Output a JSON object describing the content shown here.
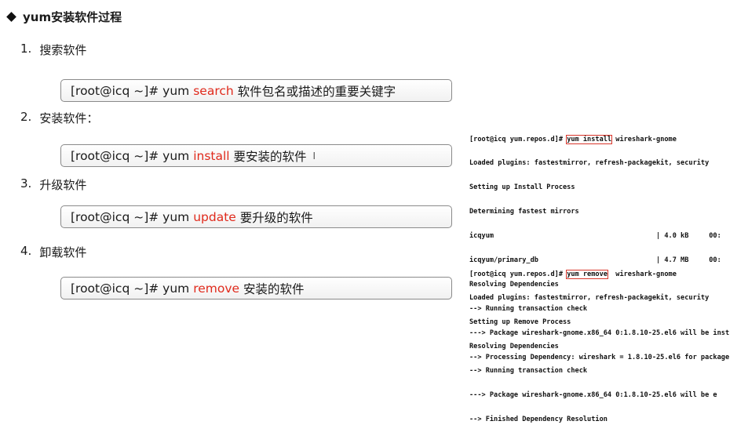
{
  "title": "yum安装软件过程",
  "steps": [
    {
      "num": "1.",
      "label": "搜索软件",
      "cmd_prefix": "[root@icq ~]# yum ",
      "cmd_keyword": "search",
      "cmd_suffix": " 软件包名或描述的重要关键字"
    },
    {
      "num": "2.",
      "label": "安装软件：",
      "cmd_prefix": "[root@icq ~]# yum ",
      "cmd_keyword": "install",
      "cmd_suffix": " 要安装的软件"
    },
    {
      "num": "3.",
      "label": "升级软件",
      "cmd_prefix": "[root@icq ~]# yum ",
      "cmd_keyword": "update",
      "cmd_suffix": " 要升级的软件"
    },
    {
      "num": "4.",
      "label": "卸载软件",
      "cmd_prefix": "[root@icq ~]# yum ",
      "cmd_keyword": "remove",
      "cmd_suffix": " 安装的软件"
    }
  ],
  "cursor_glyph": "I",
  "terminal_install": {
    "prompt": "[root@icq yum.repos.d]# ",
    "command": "yum install",
    "rest": " wireshark-gnome",
    "lines": [
      "Loaded plugins: fastestmirror, refresh-packagekit, security",
      "Setting up Install Process",
      "Determining fastest mirrors",
      "icqyum                                        | 4.0 kB     00:",
      "icqyum/primary_db                             | 4.7 MB     00:",
      "Resolving Dependencies",
      "--> Running transaction check",
      "---> Package wireshark-gnome.x86_64 0:1.8.10-25.el6 will be inst",
      "--> Processing Dependency: wireshark = 1.8.10-25.el6 for package"
    ]
  },
  "terminal_remove": {
    "prompt": "[root@icq yum.repos.d]# ",
    "command": "yum remove",
    "rest": "  wireshark-gnome",
    "lines": [
      "Loaded plugins: fastestmirror, refresh-packagekit, security",
      "Setting up Remove Process",
      "Resolving Dependencies",
      "--> Running transaction check",
      "---> Package wireshark-gnome.x86_64 0:1.8.10-25.el6 will be e",
      "--> Finished Dependency Resolution"
    ]
  }
}
